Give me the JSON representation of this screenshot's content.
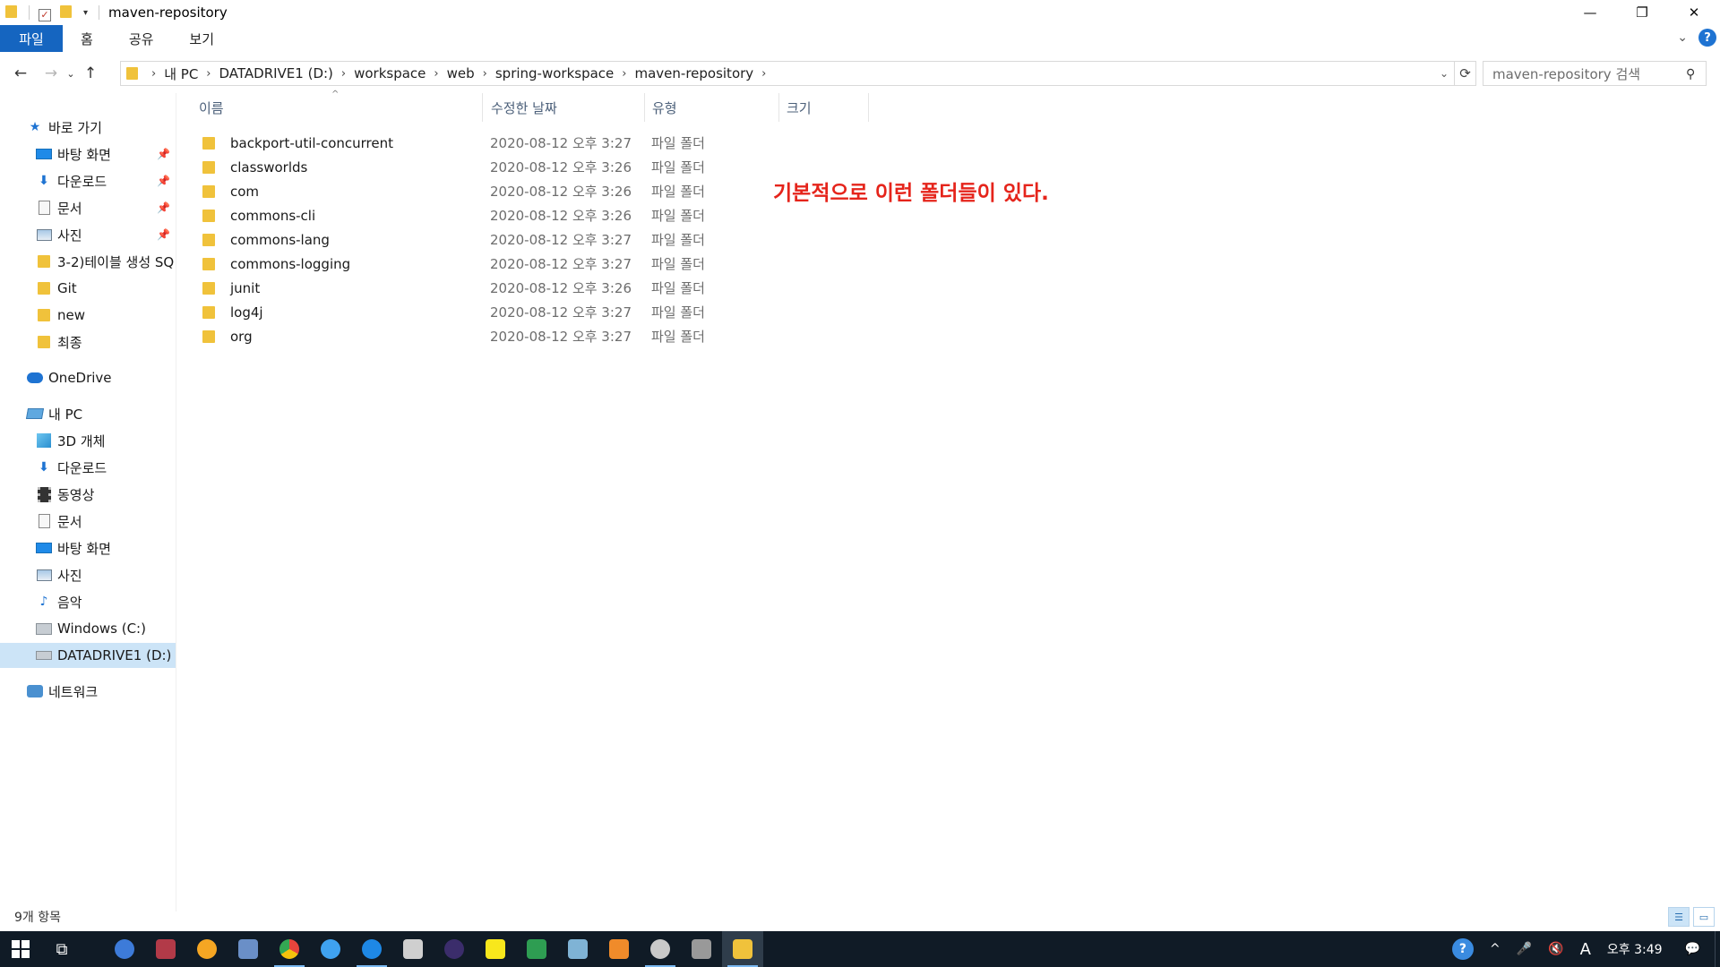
{
  "window": {
    "title": "maven-repository",
    "minimize": "—",
    "restore": "❐",
    "close": "✕"
  },
  "ribbon": {
    "tabs": [
      "파일",
      "홈",
      "공유",
      "보기"
    ]
  },
  "nav": {
    "back": "←",
    "forward": "→",
    "recent": "⌄",
    "up": "↑",
    "breadcrumbs": [
      "내 PC",
      "DATADRIVE1 (D:)",
      "workspace",
      "web",
      "spring-workspace",
      "maven-repository"
    ],
    "refresh": "⟳"
  },
  "search": {
    "placeholder": "maven-repository 검색"
  },
  "sidebar": {
    "quick_access": "바로 가기",
    "quick_items": [
      {
        "label": "바탕 화면",
        "icon": "desktop-icon",
        "pinned": true
      },
      {
        "label": "다운로드",
        "icon": "download-icon",
        "pinned": true
      },
      {
        "label": "문서",
        "icon": "document-icon",
        "pinned": true
      },
      {
        "label": "사진",
        "icon": "pictures-icon",
        "pinned": true
      },
      {
        "label": "3-2)테이블 생성 SQ",
        "icon": "folder-icon",
        "pinned": false
      },
      {
        "label": "Git",
        "icon": "folder-icon",
        "pinned": false
      },
      {
        "label": "new",
        "icon": "folder-icon",
        "pinned": false
      },
      {
        "label": "최종",
        "icon": "folder-icon",
        "pinned": false
      }
    ],
    "onedrive": "OneDrive",
    "this_pc": "내 PC",
    "pc_items": [
      {
        "label": "3D 개체",
        "icon": "3d-objects-icon"
      },
      {
        "label": "다운로드",
        "icon": "download-icon"
      },
      {
        "label": "동영상",
        "icon": "video-icon"
      },
      {
        "label": "문서",
        "icon": "document-icon"
      },
      {
        "label": "바탕 화면",
        "icon": "desktop-icon"
      },
      {
        "label": "사진",
        "icon": "pictures-icon"
      },
      {
        "label": "음악",
        "icon": "music-icon"
      },
      {
        "label": "Windows  (C:)",
        "icon": "windows-drive-icon"
      },
      {
        "label": "DATADRIVE1 (D:)",
        "icon": "drive-icon"
      }
    ],
    "network": "네트워크"
  },
  "columns": {
    "name": "이름",
    "modified": "수정한 날짜",
    "type": "유형",
    "size": "크기"
  },
  "files": [
    {
      "name": "backport-util-concurrent",
      "modified": "2020-08-12 오후 3:27",
      "type": "파일 폴더"
    },
    {
      "name": "classworlds",
      "modified": "2020-08-12 오후 3:26",
      "type": "파일 폴더"
    },
    {
      "name": "com",
      "modified": "2020-08-12 오후 3:26",
      "type": "파일 폴더"
    },
    {
      "name": "commons-cli",
      "modified": "2020-08-12 오후 3:26",
      "type": "파일 폴더"
    },
    {
      "name": "commons-lang",
      "modified": "2020-08-12 오후 3:27",
      "type": "파일 폴더"
    },
    {
      "name": "commons-logging",
      "modified": "2020-08-12 오후 3:27",
      "type": "파일 폴더"
    },
    {
      "name": "junit",
      "modified": "2020-08-12 오후 3:26",
      "type": "파일 폴더"
    },
    {
      "name": "log4j",
      "modified": "2020-08-12 오후 3:27",
      "type": "파일 폴더"
    },
    {
      "name": "org",
      "modified": "2020-08-12 오후 3:27",
      "type": "파일 폴더"
    }
  ],
  "annotation": "기본적으로 이런 폴더들이 있다.",
  "status": {
    "item_count": "9개 항목"
  },
  "taskbar": {
    "clock": "오후 3:49",
    "ime": "A",
    "apps": [
      {
        "name": "r-icon",
        "color": "#3d7bd9"
      },
      {
        "name": "winrar-icon",
        "color": "#b23a48"
      },
      {
        "name": "search-tool-icon",
        "color": "#f5a623"
      },
      {
        "name": "network-tool-icon",
        "color": "#6a8fc7"
      },
      {
        "name": "chrome-icon",
        "color": "#e8453c"
      },
      {
        "name": "internet-explorer-icon",
        "color": "#3fa2f0"
      },
      {
        "name": "edge-icon",
        "color": "#1e88e5"
      },
      {
        "name": "gear-app-icon",
        "color": "#cfcfcf"
      },
      {
        "name": "eclipse-icon",
        "color": "#3b2d6b"
      },
      {
        "name": "sticky-notes-icon",
        "color": "#f8e71c"
      },
      {
        "name": "spreadsheet-app-icon",
        "color": "#2e9d52"
      },
      {
        "name": "pen-app-icon",
        "color": "#7fb3d5"
      },
      {
        "name": "sublime-icon",
        "color": "#f08b2a"
      },
      {
        "name": "settings-app-icon",
        "color": "#c9c9c9"
      },
      {
        "name": "usb-app-icon",
        "color": "#999999"
      },
      {
        "name": "file-explorer-icon",
        "color": "#f0c23b"
      }
    ]
  },
  "colors": {
    "file_tab": "#1565c0",
    "selection": "#cce4f7",
    "annotation": "#e5241b",
    "taskbar": "#101b26"
  }
}
